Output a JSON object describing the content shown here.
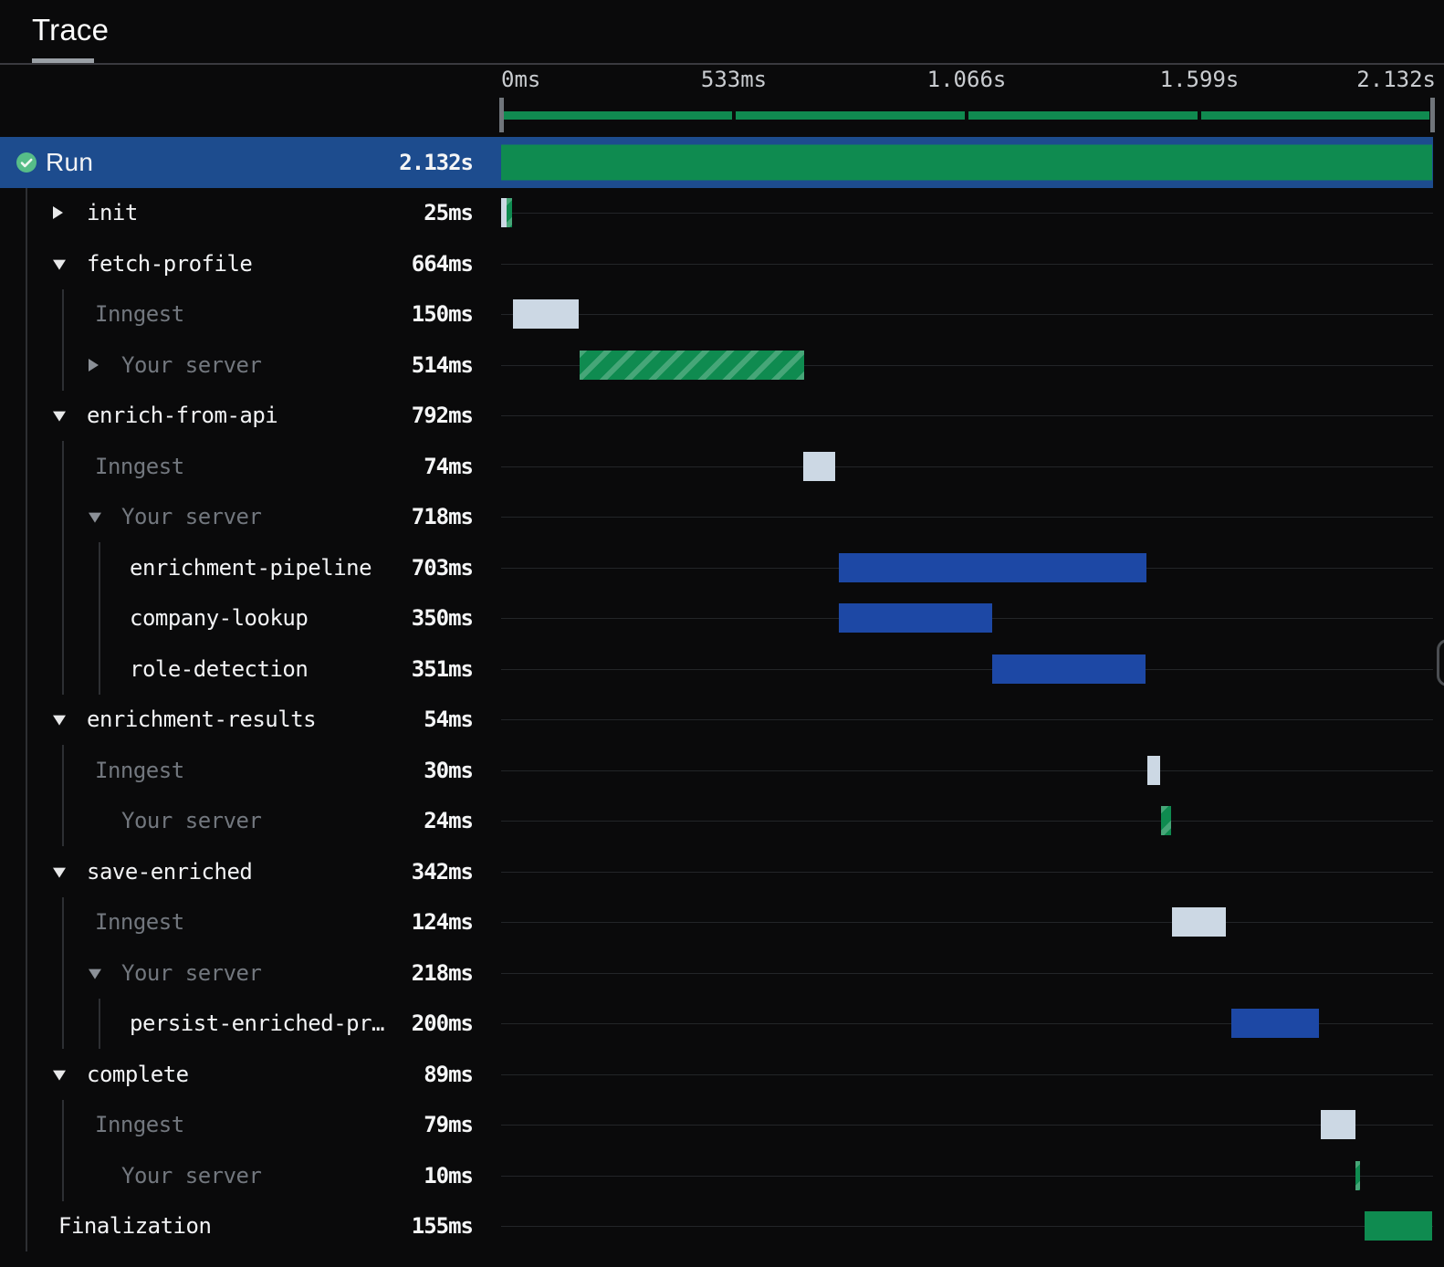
{
  "tab": {
    "label": "Trace"
  },
  "timeline": {
    "total_ms": 2132,
    "ticks": [
      {
        "label": "0ms",
        "ms": 0
      },
      {
        "label": "533ms",
        "ms": 533
      },
      {
        "label": "1.066s",
        "ms": 1066
      },
      {
        "label": "1.599s",
        "ms": 1599
      },
      {
        "label": "2.132s",
        "ms": 2132
      }
    ]
  },
  "colors": {
    "background": "#0a0a0b",
    "selected_row": "#1d4c8e",
    "bar_green": "#0f8b50",
    "bar_blue": "#1d48a5",
    "bar_gray": "#ccd8e4",
    "dim_text": "#72777e",
    "white_text": "#f2f3f5",
    "check_circle": "#57bd88"
  },
  "rows": [
    {
      "label": "Run",
      "duration": "2.132s",
      "kind": "run",
      "selected": true,
      "icon": "check-circle",
      "bars": [
        {
          "type": "green run",
          "start": 0,
          "dur": 2132
        }
      ]
    },
    {
      "label": "init",
      "duration": "25ms",
      "kind": "step",
      "chevron": "right",
      "guides": [
        0
      ],
      "bars": [
        {
          "type": "gray",
          "start": 0,
          "dur": 12
        },
        {
          "type": "hatch",
          "start": 12,
          "dur": 13
        }
      ]
    },
    {
      "label": "fetch-profile",
      "duration": "664ms",
      "kind": "step",
      "chevron": "down",
      "guides": [
        0
      ],
      "bars": []
    },
    {
      "label": "Inngest",
      "duration": "150ms",
      "kind": "inngest",
      "guides": [
        0,
        1
      ],
      "bars": [
        {
          "type": "gray",
          "start": 28,
          "dur": 150
        }
      ]
    },
    {
      "label": "Your server",
      "duration": "514ms",
      "kind": "server",
      "chevron": "right",
      "guides": [
        0,
        1
      ],
      "bars": [
        {
          "type": "hatch",
          "start": 179,
          "dur": 514
        }
      ]
    },
    {
      "label": "enrich-from-api",
      "duration": "792ms",
      "kind": "step",
      "chevron": "down",
      "guides": [
        0
      ],
      "bars": []
    },
    {
      "label": "Inngest",
      "duration": "74ms",
      "kind": "inngest",
      "guides": [
        0,
        1
      ],
      "bars": [
        {
          "type": "gray",
          "start": 691,
          "dur": 74
        }
      ]
    },
    {
      "label": "Your server",
      "duration": "718ms",
      "kind": "server",
      "chevron": "down",
      "guides": [
        0,
        1
      ],
      "bars": []
    },
    {
      "label": "enrichment-pipeline",
      "duration": "703ms",
      "kind": "substep",
      "guides": [
        0,
        1,
        2
      ],
      "bars": [
        {
          "type": "blue",
          "start": 774,
          "dur": 703
        }
      ]
    },
    {
      "label": "company-lookup",
      "duration": "350ms",
      "kind": "substep",
      "guides": [
        0,
        1,
        2
      ],
      "bars": [
        {
          "type": "blue",
          "start": 774,
          "dur": 350
        }
      ]
    },
    {
      "label": "role-detection",
      "duration": "351ms",
      "kind": "substep",
      "guides": [
        0,
        1,
        2
      ],
      "bars": [
        {
          "type": "blue",
          "start": 1124,
          "dur": 351
        }
      ]
    },
    {
      "label": "enrichment-results",
      "duration": "54ms",
      "kind": "step",
      "chevron": "down",
      "guides": [
        0
      ],
      "bars": []
    },
    {
      "label": "Inngest",
      "duration": "30ms",
      "kind": "inngest",
      "guides": [
        0,
        1
      ],
      "bars": [
        {
          "type": "gray",
          "start": 1480,
          "dur": 30
        }
      ]
    },
    {
      "label": "Your server",
      "duration": "24ms",
      "kind": "server",
      "guides": [
        0,
        1
      ],
      "bars": [
        {
          "type": "hatch",
          "start": 1511,
          "dur": 24
        }
      ]
    },
    {
      "label": "save-enriched",
      "duration": "342ms",
      "kind": "step",
      "chevron": "down",
      "guides": [
        0
      ],
      "bars": []
    },
    {
      "label": "Inngest",
      "duration": "124ms",
      "kind": "inngest",
      "guides": [
        0,
        1
      ],
      "bars": [
        {
          "type": "gray",
          "start": 1536,
          "dur": 124
        }
      ]
    },
    {
      "label": "Your server",
      "duration": "218ms",
      "kind": "server",
      "chevron": "down",
      "guides": [
        0,
        1
      ],
      "bars": []
    },
    {
      "label": "persist-enriched-pr…",
      "duration": "200ms",
      "kind": "substep",
      "guides": [
        0,
        1,
        2
      ],
      "bars": [
        {
          "type": "blue",
          "start": 1672,
          "dur": 200
        }
      ]
    },
    {
      "label": "complete",
      "duration": "89ms",
      "kind": "step",
      "chevron": "down",
      "guides": [
        0
      ],
      "bars": []
    },
    {
      "label": "Inngest",
      "duration": "79ms",
      "kind": "inngest",
      "guides": [
        0,
        1
      ],
      "bars": [
        {
          "type": "gray",
          "start": 1878,
          "dur": 79
        }
      ]
    },
    {
      "label": "Your server",
      "duration": "10ms",
      "kind": "server",
      "guides": [
        0,
        1
      ],
      "bars": [
        {
          "type": "hatch",
          "start": 1957,
          "dur": 10
        }
      ]
    },
    {
      "label": "Finalization",
      "duration": "155ms",
      "kind": "finalization",
      "guides": [
        0
      ],
      "bars": [
        {
          "type": "green",
          "start": 1977,
          "dur": 155
        }
      ]
    }
  ]
}
